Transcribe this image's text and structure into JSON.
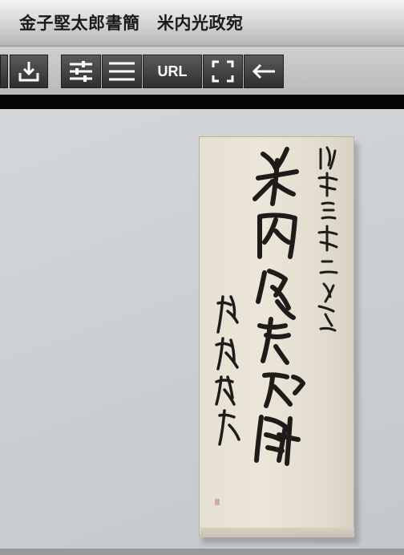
{
  "window": {
    "title": "金子堅太郎書簡　米内光政宛"
  },
  "toolbar": {
    "buttons": [
      {
        "name": "prev-partial",
        "icon": "panel-edge-icon"
      },
      {
        "name": "download",
        "icon": "download-icon"
      },
      {
        "name": "adjust",
        "icon": "sliders-icon"
      },
      {
        "name": "menu",
        "icon": "hamburger-icon"
      },
      {
        "name": "url",
        "label": "URL"
      },
      {
        "name": "fullscreen",
        "icon": "fullscreen-icon"
      },
      {
        "name": "back",
        "icon": "arrow-left-icon"
      }
    ]
  },
  "viewer": {
    "document": "handwritten-envelope"
  }
}
